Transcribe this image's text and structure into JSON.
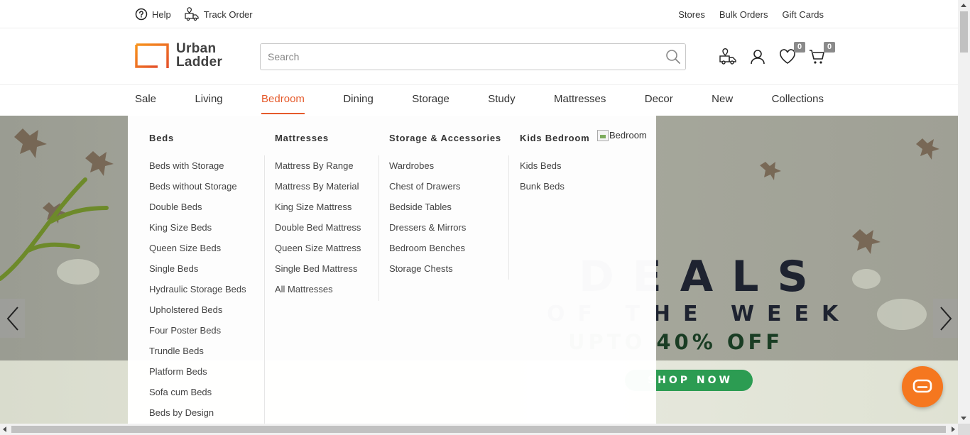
{
  "topbar": {
    "help_label": "Help",
    "track_label": "Track Order",
    "stores_label": "Stores",
    "bulk_label": "Bulk Orders",
    "gift_label": "Gift Cards"
  },
  "header": {
    "logo_line1": "Urban",
    "logo_line2": "Ladder",
    "search_placeholder": "Search",
    "wishlist_count": "0",
    "cart_count": "0"
  },
  "nav": {
    "items": [
      "Sale",
      "Living",
      "Bedroom",
      "Dining",
      "Storage",
      "Study",
      "Mattresses",
      "Decor",
      "New",
      "Collections"
    ],
    "active": "Bedroom"
  },
  "mega_menu": {
    "columns": [
      {
        "title": "Beds",
        "items": [
          "Beds with Storage",
          "Beds without Storage",
          "Double Beds",
          "King Size Beds",
          "Queen Size Beds",
          "Single Beds",
          "Hydraulic Storage Beds",
          "Upholstered Beds",
          "Four Poster Beds",
          "Trundle Beds",
          "Platform Beds",
          "Sofa cum Beds",
          "Beds by Design"
        ]
      },
      {
        "title": "Mattresses",
        "items": [
          "Mattress By Range",
          "Mattress By Material",
          "King Size Mattress",
          "Double Bed Mattress",
          "Queen Size Mattress",
          "Single Bed Mattress",
          "All Mattresses"
        ]
      },
      {
        "title": "Storage & Accessories",
        "items": [
          "Wardrobes",
          "Chest of Drawers",
          "Bedside Tables",
          "Dressers & Mirrors",
          "Bedroom Benches",
          "Storage Chests"
        ]
      },
      {
        "title": "Kids Bedroom",
        "items": [
          "Kids Beds",
          "Bunk Beds"
        ]
      }
    ],
    "image_alt": "Bedroom"
  },
  "banner": {
    "line1": "DEALS",
    "line2": "OF THE WEEK",
    "line3": "UPTO 40% OFF",
    "cta": "SHOP NOW"
  },
  "colors": {
    "accent": "#e55a2b",
    "chat": "#f5771f",
    "cta": "#2c9c52"
  }
}
